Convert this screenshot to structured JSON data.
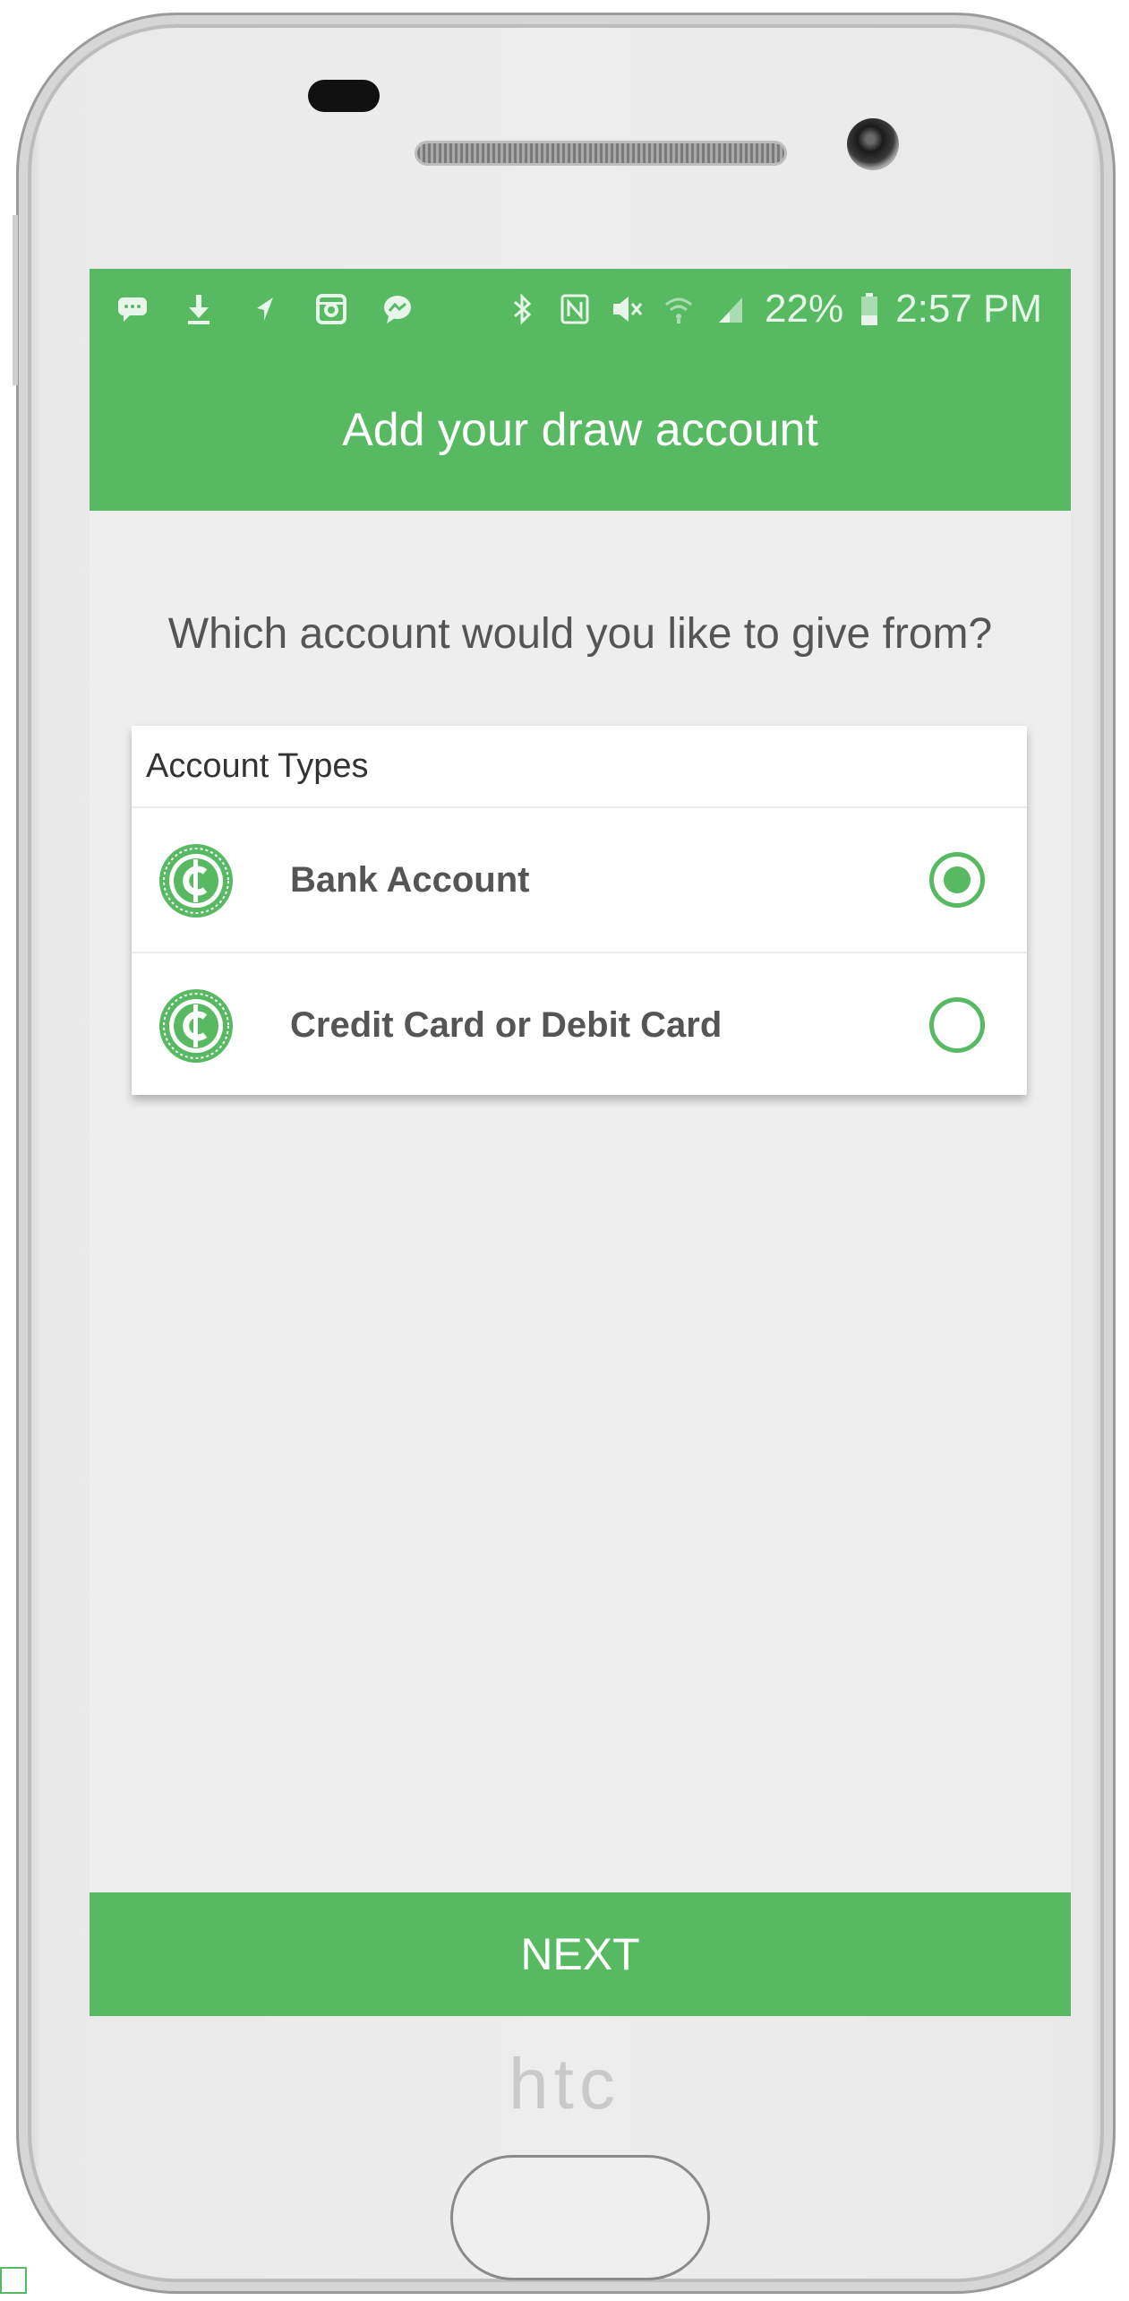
{
  "status_bar": {
    "battery": "22%",
    "time": "2:57 PM",
    "left_icons": [
      "message-icon",
      "download-icon",
      "navigation-icon",
      "instagram-icon",
      "messenger-icon"
    ],
    "right_icons": [
      "bluetooth-icon",
      "nfc-icon",
      "mute-icon",
      "wifi-icon",
      "signal-icon",
      "battery-icon"
    ]
  },
  "header": {
    "title": "Add your draw account"
  },
  "main": {
    "question": "Which account would you like to give from?",
    "account_types": {
      "heading": "Account Types",
      "options": [
        {
          "label": "Bank Account",
          "selected": true,
          "icon": "cent-coin-icon"
        },
        {
          "label": "Credit Card or Debit Card",
          "selected": false,
          "icon": "cent-coin-icon"
        }
      ]
    }
  },
  "footer": {
    "next_label": "NEXT"
  },
  "device": {
    "brand": "htc"
  },
  "colors": {
    "accent": "#57ba63",
    "background": "#eeeeee",
    "text": "#555555"
  }
}
